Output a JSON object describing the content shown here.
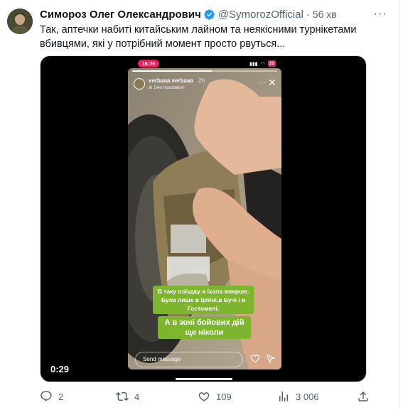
{
  "tweet": {
    "author_name": "Симороз Олег Олександрович",
    "author_handle": "@SymorozOfficial",
    "separator": "·",
    "time": "56 хв",
    "text": "Так, аптечки набиті китайським лайном та неякісними турнікетами вбивцями, які у потрібний момент просто рвуться...",
    "more_icon": "ellipsis-icon",
    "verified_icon": "verified-badge-icon"
  },
  "media": {
    "duration": "0:29",
    "phone_status_time": "16:36",
    "battery": "20",
    "story": {
      "username": "verbaaa.verbaaa",
      "age": "2h",
      "translate_label": "See translation",
      "caption_1": "В таку поїздку я їхала вперше. Була лише в Ірпіні,в Бучі і в Гостомелі.",
      "caption_2": "А в зоні бойових дій ще ніколи",
      "send_placeholder": "Send message",
      "progress": 0.55
    }
  },
  "actions": {
    "replies": "2",
    "retweets": "4",
    "likes": "109",
    "views": "3 006"
  },
  "colors": {
    "text_primary": "#0f1419",
    "text_secondary": "#536471",
    "verified_blue": "#1d9bf0",
    "caption_green": "#7db52c",
    "recording_red": "#e0245e"
  }
}
